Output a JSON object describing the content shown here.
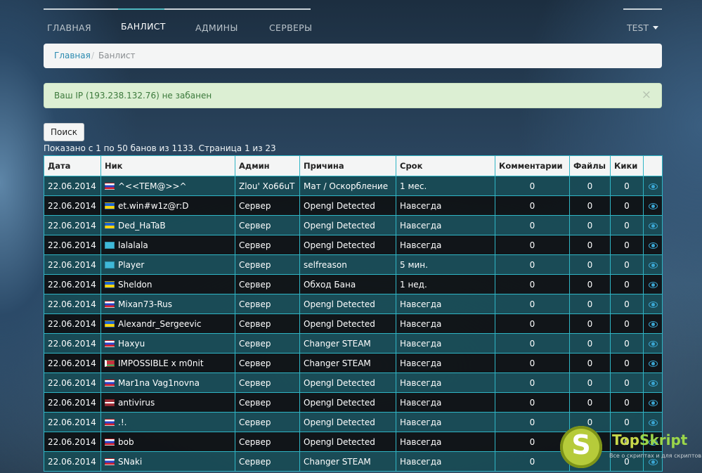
{
  "nav": {
    "items": [
      {
        "label": "ГЛАВНАЯ"
      },
      {
        "label": "БАНЛИСТ"
      },
      {
        "label": "АДМИНЫ"
      },
      {
        "label": "СЕРВЕРЫ"
      }
    ],
    "active_index": 1,
    "user_label": "TEST"
  },
  "breadcrumb": {
    "home": "Главная",
    "separator": "/",
    "current": "Банлист"
  },
  "alert": {
    "message": "Ваш IP (193.238.132.76) не забанен",
    "close": "×"
  },
  "search": {
    "button_label": "Поиск"
  },
  "listing": {
    "info": "Показано с 1 по 50 банов из 1133. Страница 1 из 23"
  },
  "table": {
    "headers": [
      "Дата",
      "Ник",
      "Админ",
      "Причина",
      "Срок",
      "Комментарии",
      "Файлы",
      "Кики"
    ],
    "rows": [
      {
        "date": "22.06.2014",
        "flag": "ru",
        "nick": "^<<TEM@>>^",
        "admin": "Zlou' Xo66uT",
        "reason": "Мат / Оскорбление",
        "term": "1 мес.",
        "comments": "0",
        "files": "0",
        "kicks": "0"
      },
      {
        "date": "22.06.2014",
        "flag": "ua",
        "nick": "et.win#w1z@r:D",
        "admin": "Сервер",
        "reason": "Opengl Detected",
        "term": "Навсегда",
        "comments": "0",
        "files": "0",
        "kicks": "0"
      },
      {
        "date": "22.06.2014",
        "flag": "ua",
        "nick": "Ded_HaTaB",
        "admin": "Сервер",
        "reason": "Opengl Detected",
        "term": "Навсегда",
        "comments": "0",
        "files": "0",
        "kicks": "0"
      },
      {
        "date": "22.06.2014",
        "flag": "kz",
        "nick": "lalalala",
        "admin": "Сервер",
        "reason": "Opengl Detected",
        "term": "Навсегда",
        "comments": "0",
        "files": "0",
        "kicks": "0"
      },
      {
        "date": "22.06.2014",
        "flag": "kz",
        "nick": "Player",
        "admin": "Сервер",
        "reason": "selfreason",
        "term": "5 мин.",
        "comments": "0",
        "files": "0",
        "kicks": "0"
      },
      {
        "date": "22.06.2014",
        "flag": "ua",
        "nick": "Sheldon",
        "admin": "Сервер",
        "reason": "Обход Бана",
        "term": "1 нед.",
        "comments": "0",
        "files": "0",
        "kicks": "0"
      },
      {
        "date": "22.06.2014",
        "flag": "ru",
        "nick": "Mixan73-Rus",
        "admin": "Сервер",
        "reason": "Opengl Detected",
        "term": "Навсегда",
        "comments": "0",
        "files": "0",
        "kicks": "0"
      },
      {
        "date": "22.06.2014",
        "flag": "ua",
        "nick": "Alexandr_Sergeevic",
        "admin": "Сервер",
        "reason": "Opengl Detected",
        "term": "Навсегда",
        "comments": "0",
        "files": "0",
        "kicks": "0"
      },
      {
        "date": "22.06.2014",
        "flag": "ru",
        "nick": "Haxyu",
        "admin": "Сервер",
        "reason": "Changer STEAM",
        "term": "Навсегда",
        "comments": "0",
        "files": "0",
        "kicks": "0"
      },
      {
        "date": "22.06.2014",
        "flag": "by",
        "nick": "IMPOSSIBLE x m0nit",
        "admin": "Сервер",
        "reason": "Changer STEAM",
        "term": "Навсегда",
        "comments": "0",
        "files": "0",
        "kicks": "0"
      },
      {
        "date": "22.06.2014",
        "flag": "ru",
        "nick": "Mar1na Vag1novna",
        "admin": "Сервер",
        "reason": "Opengl Detected",
        "term": "Навсегда",
        "comments": "0",
        "files": "0",
        "kicks": "0"
      },
      {
        "date": "22.06.2014",
        "flag": "lv",
        "nick": "antivirus",
        "admin": "Сервер",
        "reason": "Opengl Detected",
        "term": "Навсегда",
        "comments": "0",
        "files": "0",
        "kicks": "0"
      },
      {
        "date": "22.06.2014",
        "flag": "ru",
        "nick": ".!.",
        "admin": "Сервер",
        "reason": "Opengl Detected",
        "term": "Навсегда",
        "comments": "0",
        "files": "0",
        "kicks": "0"
      },
      {
        "date": "22.06.2014",
        "flag": "ru",
        "nick": "bob",
        "admin": "Сервер",
        "reason": "Opengl Detected",
        "term": "Навсегда",
        "comments": "0",
        "files": "0",
        "kicks": "0"
      },
      {
        "date": "22.06.2014",
        "flag": "ru",
        "nick": "SNaki",
        "admin": "Сервер",
        "reason": "Changer STEAM",
        "term": "Навсегда",
        "comments": "0",
        "files": "0",
        "kicks": "0"
      }
    ],
    "row_action_icon": "eye-icon"
  },
  "watermark": {
    "logo_letter": "S",
    "brand_top": "Top",
    "brand_rest": "Skript",
    "tagline": "Все о скриптах и для скриптов..."
  },
  "colors": {
    "accent": "#4fb9c0",
    "table_border": "#2fb5c5",
    "alert_bg": "#dcefd3",
    "alert_text": "#3c7a3c",
    "link": "#2a8ab0"
  }
}
